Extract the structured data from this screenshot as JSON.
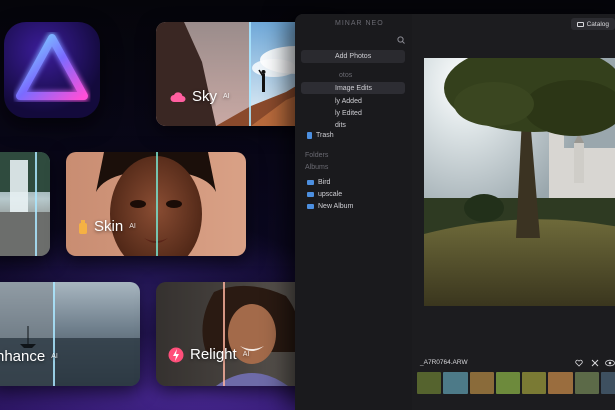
{
  "app_icon": {
    "name": "luminar-triangle-icon"
  },
  "cards": {
    "sky": {
      "label": "Sky",
      "ai_tag": "AI"
    },
    "skin": {
      "label": "Skin",
      "ai_tag": "AI"
    },
    "enhance": {
      "label": "nhance",
      "ai_tag": "AI"
    },
    "relight": {
      "label": "Relight",
      "ai_tag": "AI"
    }
  },
  "window": {
    "title": "MINAR NEO",
    "catalog_button": "Catalog",
    "sidebar": {
      "add_photos": "Add Photos",
      "section_photos": "otos",
      "items": [
        {
          "label": "Image Edits",
          "selected": true
        },
        {
          "label": "ly Added",
          "selected": false
        },
        {
          "label": "ly Edited",
          "selected": false
        },
        {
          "label": "dits",
          "selected": false
        },
        {
          "label": "Trash",
          "selected": false
        }
      ],
      "section_folders": "Folders",
      "section_albums": "Albums",
      "albums": [
        {
          "label": "Bird"
        },
        {
          "label": "upscale"
        },
        {
          "label": "New Album"
        }
      ]
    },
    "filename": "_A7R0764.ARW"
  },
  "colors": {
    "accent": "#4c8fe0",
    "divider": "#aae6ff"
  }
}
